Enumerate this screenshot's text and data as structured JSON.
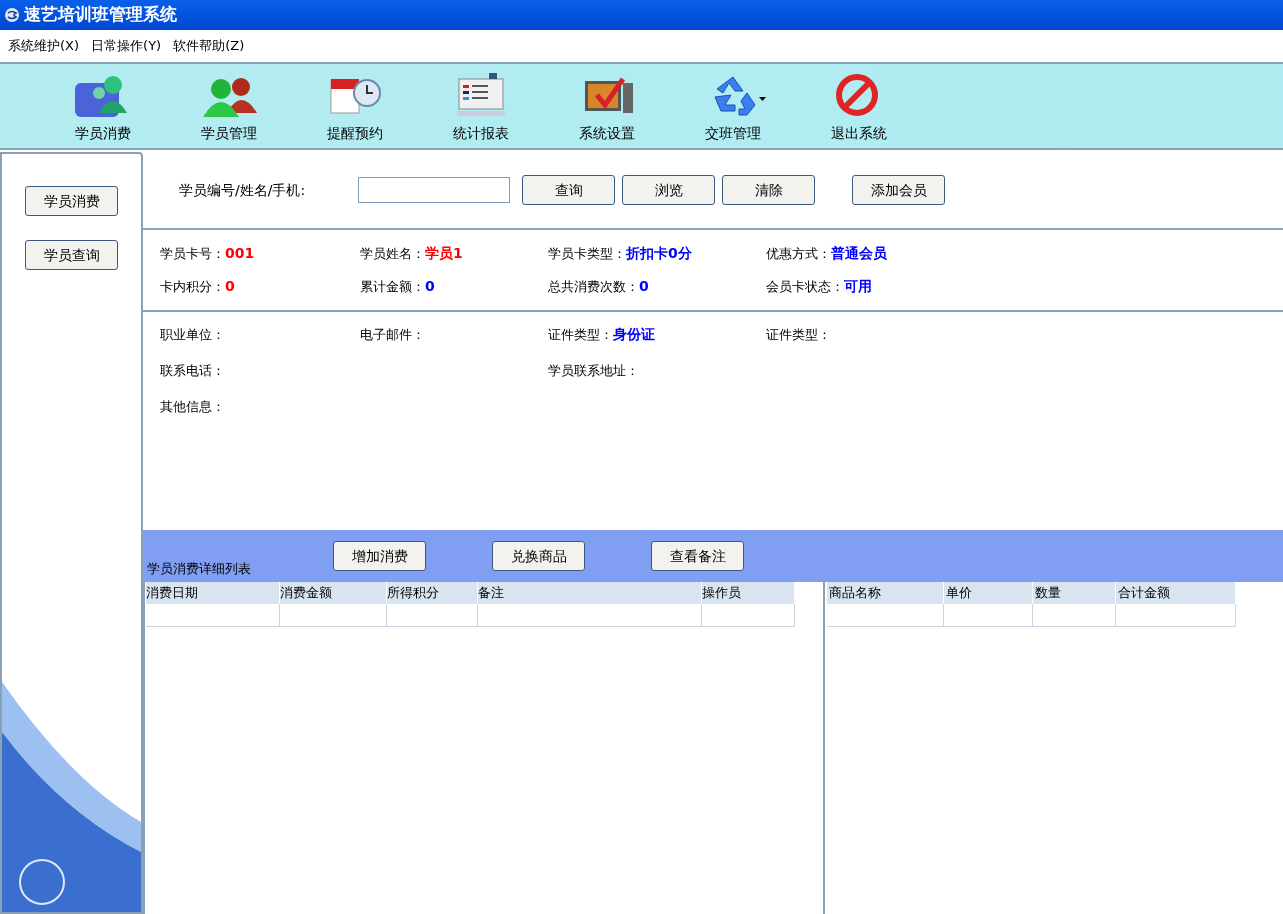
{
  "window": {
    "title": "速艺培训班管理系统"
  },
  "menu": [
    "系统维护(X)",
    "日常操作(Y)",
    "软件帮助(Z)"
  ],
  "toolbar": [
    {
      "label": "学员消费",
      "kind": "consume",
      "dropdown": false
    },
    {
      "label": "学员管理",
      "kind": "members",
      "dropdown": false
    },
    {
      "label": "提醒预约",
      "kind": "calendar",
      "dropdown": false
    },
    {
      "label": "统计报表",
      "kind": "report",
      "dropdown": false
    },
    {
      "label": "系统设置",
      "kind": "settings",
      "dropdown": false
    },
    {
      "label": "交班管理",
      "kind": "shift",
      "dropdown": true
    },
    {
      "label": "退出系统",
      "kind": "exit",
      "dropdown": false
    }
  ],
  "sidebar": {
    "buttons": [
      "学员消费",
      "学员查询"
    ]
  },
  "search": {
    "label": "学员编号/姓名/手机:",
    "buttons": [
      "查询",
      "浏览",
      "清除"
    ],
    "add_button": "添加会员"
  },
  "card_info": [
    {
      "label": "学员卡号：",
      "value": "001",
      "color": "#ff0000"
    },
    {
      "label": "学员姓名：",
      "value": "学员1",
      "color": "#ff0000"
    },
    {
      "label": "学员卡类型：",
      "value": "折扣卡0分",
      "color": "#0000ff"
    },
    {
      "label": "优惠方式：",
      "value": "普通会员",
      "color": "#0000ff"
    },
    {
      "label": "卡内积分：",
      "value": "0",
      "color": "#ff0000"
    },
    {
      "label": "累计金额：",
      "value": "0",
      "color": "#0000ff"
    },
    {
      "label": "总共消费次数：",
      "value": "0",
      "color": "#0000ff"
    },
    {
      "label": "会员卡状态：",
      "value": "可用",
      "color": "#0000ff"
    }
  ],
  "details": [
    {
      "label": "职业单位：",
      "kind": "field"
    },
    {
      "label": "电子邮件：",
      "kind": "field"
    },
    {
      "label": "证件类型：",
      "value": "身份证",
      "kind": "field"
    },
    {
      "label": "证件类型：",
      "kind": "field"
    },
    {
      "label": "联系电话：",
      "kind": "wide"
    },
    {
      "label": "学员联系地址：",
      "kind": "wide"
    },
    {
      "label": "其他信息：",
      "kind": "field"
    }
  ],
  "detail_bar": {
    "title": "学员消费详细列表",
    "buttons": [
      "增加消费",
      "兑换商品",
      "查看备注"
    ]
  },
  "consume_table": {
    "columns": [
      "消费日期",
      "消费金额",
      "所得积分",
      "备注",
      "操作员"
    ]
  },
  "goods_table": {
    "columns": [
      "商品名称",
      "单价",
      "数量",
      "合计金额"
    ]
  }
}
